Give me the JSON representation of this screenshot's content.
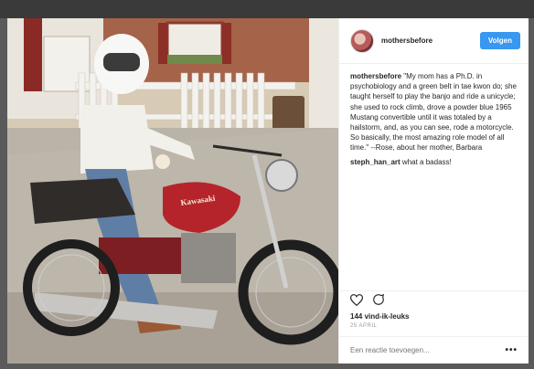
{
  "header": {
    "username": "mothersbefore",
    "follow_label": "Volgen"
  },
  "comments": [
    {
      "user": "mothersbefore",
      "text": "\"My mom has a Ph.D. in psychobiology and a green belt in tae kwon do; she taught herself to play the banjo and ride a unicycle; she used to rock climb, drove a powder blue 1965 Mustang convertible until it was totaled by a hailstorm, and, as you can see, rode a motorcycle. So basically, the most amazing role model of all time.\" --Rose, about her mother, Barbara"
    },
    {
      "user": "steph_han_art",
      "text": "what a badass!"
    }
  ],
  "actions": {
    "like_icon": "heart-icon",
    "comment_icon": "comment-icon"
  },
  "likes": "144 vind-ik-leuks",
  "date": "25 APRIL",
  "add_comment": {
    "placeholder": "Een reactie toevoegen...",
    "more_icon": "more-options-icon"
  },
  "photo": {
    "tank_brand": "Kawasaki"
  },
  "colors": {
    "accent": "#3897f0",
    "text": "#262626",
    "muted": "#999999"
  }
}
